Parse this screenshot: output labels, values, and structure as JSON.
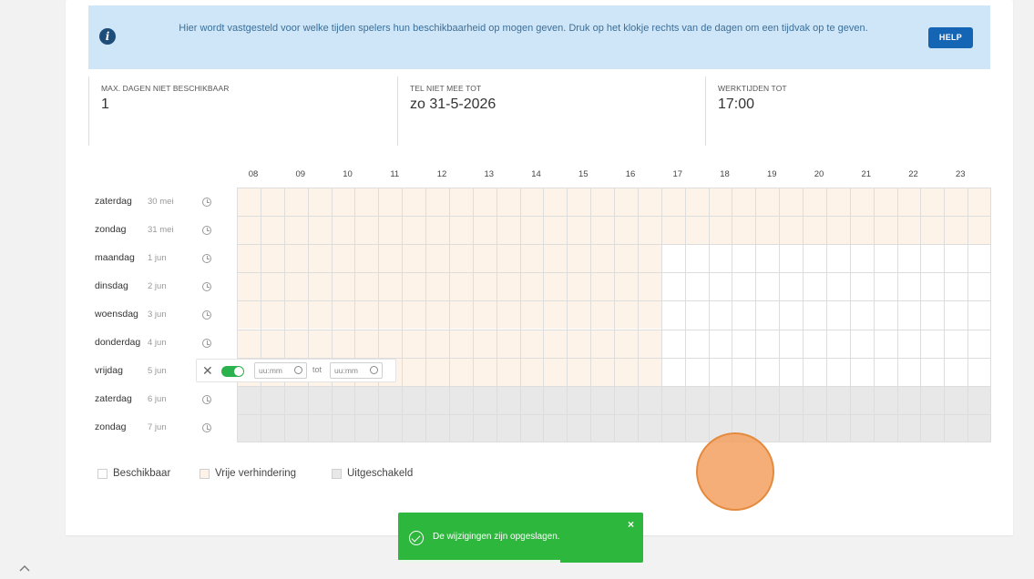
{
  "info": {
    "text": "Hier wordt vastgesteld voor welke tijden spelers hun beschikbaarheid op mogen geven. Druk op het klokje rechts van de dagen om een tijdvak op te geven.",
    "help_label": "HELP"
  },
  "fields": [
    {
      "label": "MAX. DAGEN NIET BESCHIKBAAR",
      "value": "1"
    },
    {
      "label": "TEL NIET MEE TOT",
      "value": "zo 31-5-2026"
    },
    {
      "label": "WERKTIJDEN TOT",
      "value": "17:00"
    }
  ],
  "hours": [
    "08",
    "09",
    "10",
    "11",
    "12",
    "13",
    "14",
    "15",
    "16",
    "17",
    "18",
    "19",
    "20",
    "21",
    "22",
    "23"
  ],
  "days": [
    {
      "day": "zaterdag",
      "date": "30 mei",
      "state": "vrij"
    },
    {
      "day": "zondag",
      "date": "31 mei",
      "state": "vrij"
    },
    {
      "day": "maandag",
      "date": "1 jun",
      "state": "werk"
    },
    {
      "day": "dinsdag",
      "date": "2 jun",
      "state": "werk"
    },
    {
      "day": "woensdag",
      "date": "3 jun",
      "state": "werk"
    },
    {
      "day": "donderdag",
      "date": "4 jun",
      "state": "werk"
    },
    {
      "day": "vrijdag",
      "date": "5 jun",
      "state": "werk"
    },
    {
      "day": "zaterdag",
      "date": "6 jun",
      "state": "uit"
    },
    {
      "day": "zondag",
      "date": "7 jun",
      "state": "uit"
    }
  ],
  "edit_row": {
    "from_placeholder": "uu:mm",
    "to_label": "tot",
    "to_placeholder": "uu:mm",
    "enabled": true
  },
  "legend": [
    "Beschikbaar",
    "Vrije verhindering",
    "Uitgeschakeld"
  ],
  "toast": {
    "message": "De wijzigingen zijn opgeslagen.",
    "close": "×",
    "progress": 0.66
  },
  "colors": {
    "vrij": "#fdf3e8",
    "uit": "#e8e8e8",
    "beschikbaar": "#ffffff",
    "info_bg": "#cfe6f8",
    "help_button": "#1565b5",
    "toast": "#2eb73d"
  }
}
